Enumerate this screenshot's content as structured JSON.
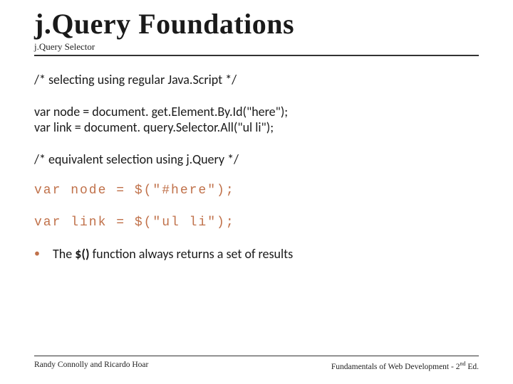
{
  "header": {
    "title": "j.Query Foundations",
    "subtitle": "j.Query Selector"
  },
  "body": {
    "comment1": "/* selecting using regular Java.Script */",
    "code_line1": "var node = document. get.Element.By.Id(\"here\");",
    "code_line2": "var link = document. query.Selector.All(\"ul li\");",
    "comment2": "/* equivalent selection using j.Query */",
    "jq_line1": "var node = $(\"#here\");",
    "jq_line2": "var link = $(\"ul li\");",
    "bullet_pre": "The ",
    "bullet_fn": "$()",
    "bullet_post": "  function always returns a set of results"
  },
  "footer": {
    "left": "Randy Connolly and Ricardo Hoar",
    "right_pre": "Fundamentals of Web Development - 2",
    "right_sup": "nd",
    "right_post": " Ed."
  }
}
